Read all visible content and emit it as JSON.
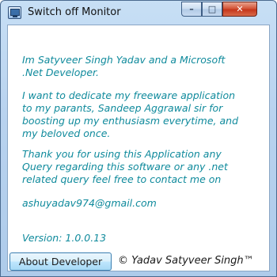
{
  "window": {
    "title": "Switch off Monitor",
    "controls": {
      "minimize": "–",
      "maximize": "□",
      "close": "✕"
    }
  },
  "content": {
    "intro": "Im Satyveer Singh Yadav and a Microsoft\n.Net Developer.",
    "dedication": "I want to dedicate my freeware application\nto my parants, Sandeep Aggrawal sir for\nboosting up my enthusiasm everytime, and\nmy beloved once.",
    "thanks": "Thank you for using this Application any\nQuery regarding this software or any .net\nrelated query feel free to contact me on",
    "email": "ashuyadav974@gmail.com",
    "version": "Version: 1.0.0.13"
  },
  "footer": {
    "about_button": "About Developer",
    "copyright": "© Yadav Satyveer Singh™"
  },
  "colors": {
    "message_text": "#0f8a9c",
    "frame": "#b9d3ef",
    "close_button": "#c5371c"
  }
}
